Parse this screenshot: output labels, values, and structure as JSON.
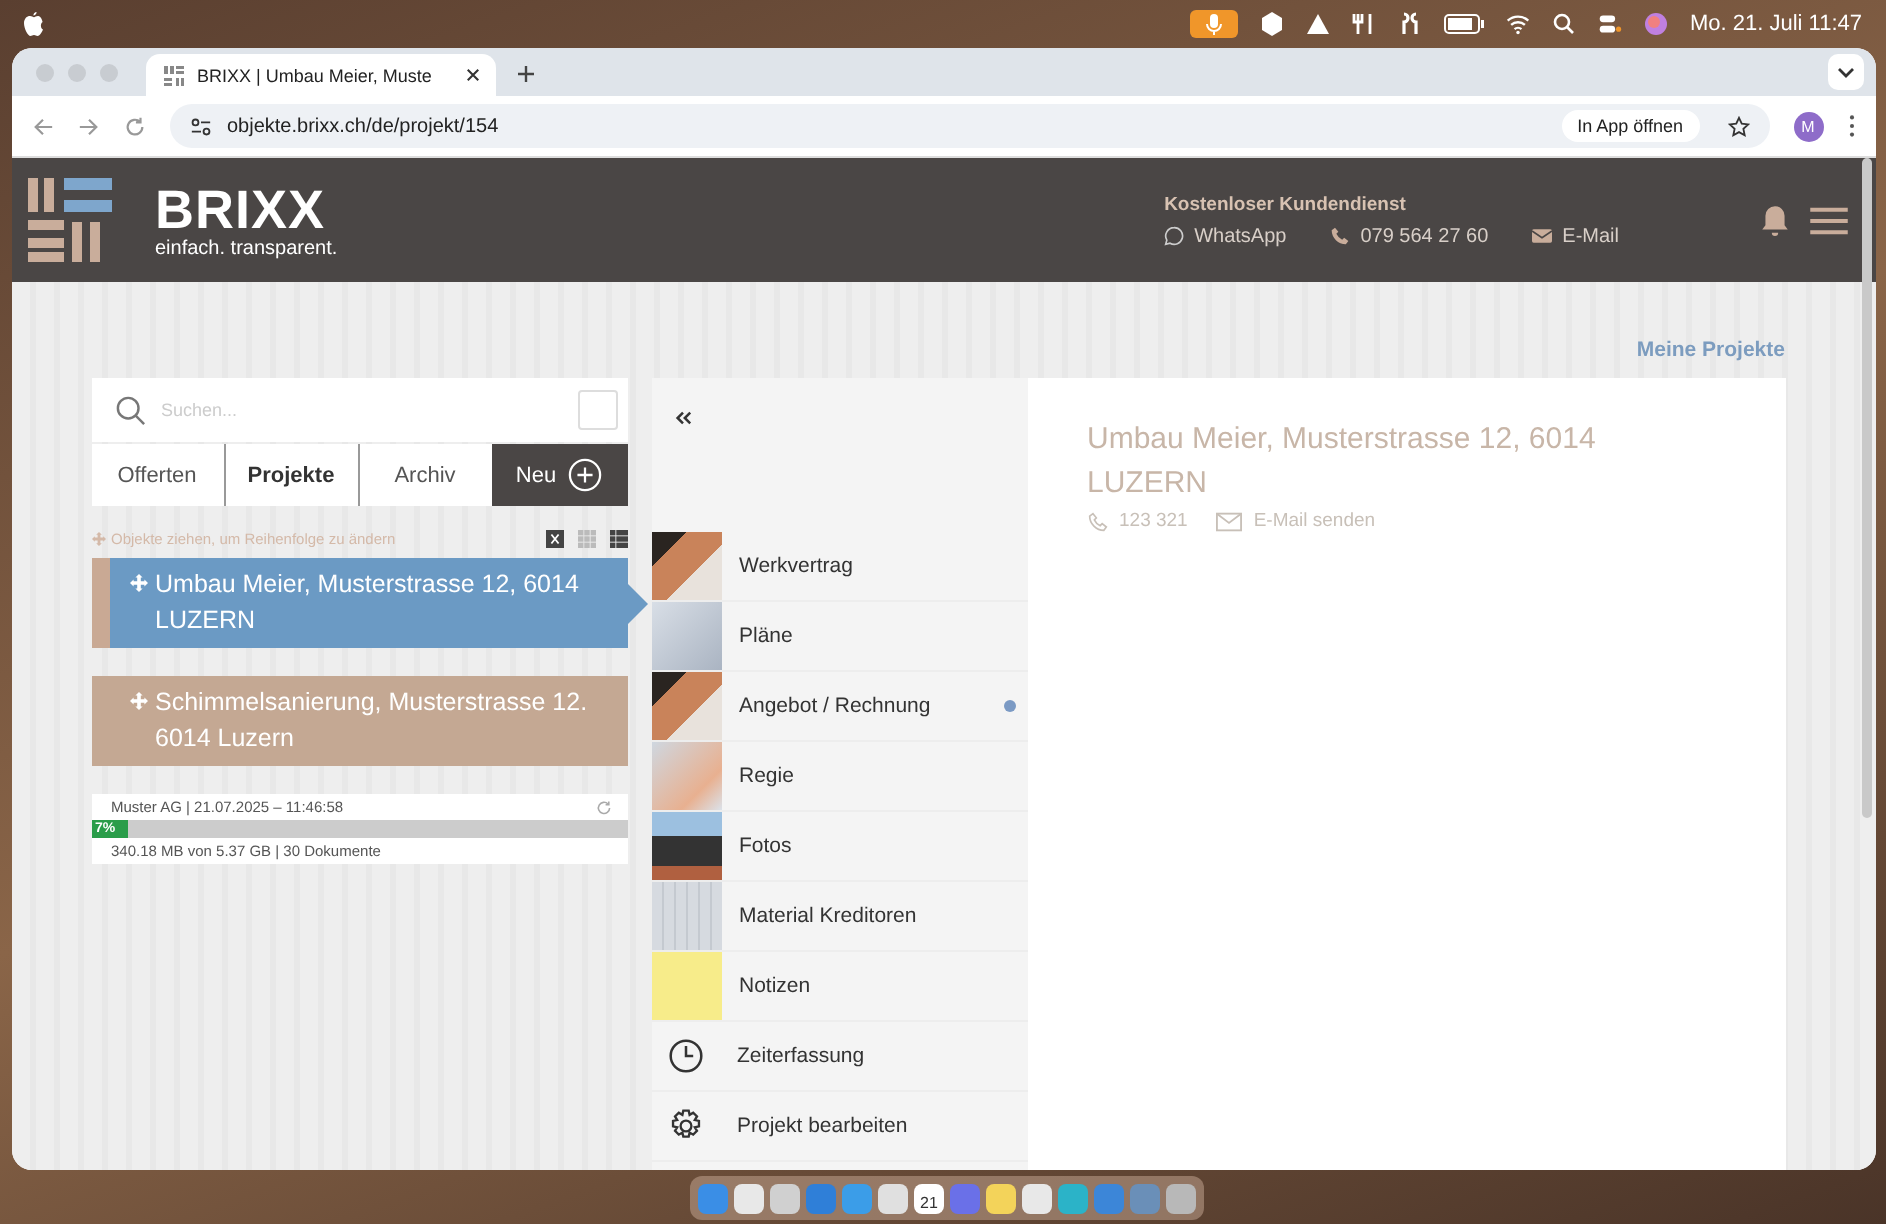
{
  "menubar": {
    "date_time": "Mo. 21. Juli  11:47"
  },
  "browser": {
    "tab_title": "BRIXX | Umbau Meier, Muste",
    "url": "objekte.brixx.ch/de/projekt/154",
    "open_in_app": "In App öffnen",
    "profile_initial": "M"
  },
  "header": {
    "logo": "BRIXX",
    "tagline": "einfach. transparent.",
    "support_title": "Kostenloser Kundendienst",
    "contacts": [
      {
        "kind": "whatsapp",
        "label": "WhatsApp"
      },
      {
        "kind": "phone",
        "label": "079 564 27 60"
      },
      {
        "kind": "mail",
        "label": "E-Mail"
      }
    ]
  },
  "my_projects_link": "Meine Projekte",
  "sidebar": {
    "search": {
      "placeholder": "Suchen..."
    },
    "checkbox": {
      "checked": false
    },
    "tabs": [
      {
        "label": "Offerten",
        "selected": false
      },
      {
        "label": "Projekte",
        "selected": true
      },
      {
        "label": "Archiv",
        "selected": false
      }
    ],
    "new_button": "Neu",
    "hint": "Objekte ziehen, um Reihenfolge zu ändern",
    "projects": [
      {
        "title": "Umbau Meier, Musterstrasse 12, 6014 LUZERN",
        "selected": true
      },
      {
        "title": "Schimmelsanierung, Musterstrasse 12. 6014 Luzern",
        "selected": false
      }
    ],
    "storage": {
      "owner_date": "Muster AG | 21.07.2025 – 11:46:58",
      "level": 0.07,
      "percent": "7%",
      "usage": "340.18 MB von 5.37 GB | 30 Dokumente"
    }
  },
  "menu": [
    {
      "label": "Werkvertrag",
      "kind": "handshake",
      "dot": false
    },
    {
      "label": "Pläne",
      "kind": "plans",
      "dot": false
    },
    {
      "label": "Angebot / Rechnung",
      "kind": "handshake",
      "dot": true
    },
    {
      "label": "Regie",
      "kind": "paper",
      "dot": false
    },
    {
      "label": "Fotos",
      "kind": "photo",
      "dot": false
    },
    {
      "label": "Material Kreditoren",
      "kind": "keyboard",
      "dot": false
    },
    {
      "label": "Notizen",
      "kind": "note",
      "dot": false
    },
    {
      "label": "Zeiterfassung",
      "kind": "clock",
      "dot": false
    },
    {
      "label": "Projekt bearbeiten",
      "kind": "gear",
      "dot": false
    }
  ],
  "detail": {
    "title": "Umbau Meier, Musterstrasse 12, 6014 LUZERN",
    "phone": "123 321",
    "email": "E-Mail senden"
  },
  "dock": {
    "calendar_day": "21"
  }
}
